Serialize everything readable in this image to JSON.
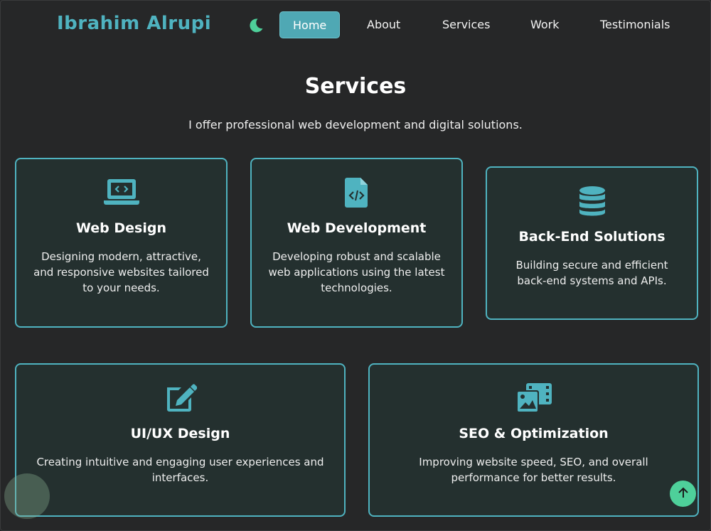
{
  "header": {
    "brand": "Ibrahim Alrupi",
    "theme_icon": "moon-icon",
    "nav": [
      {
        "label": "Home",
        "active": true
      },
      {
        "label": "About",
        "active": false
      },
      {
        "label": "Services",
        "active": false
      },
      {
        "label": "Work",
        "active": false
      },
      {
        "label": "Testimonials",
        "active": false
      }
    ]
  },
  "services": {
    "title": "Services",
    "subtitle": "I offer professional web development and digital solutions.",
    "cards": [
      {
        "icon": "laptop-code-icon",
        "title": "Web Design",
        "desc": "Designing modern, attractive, and responsive websites tailored to your needs."
      },
      {
        "icon": "file-code-icon",
        "title": "Web Development",
        "desc": "Developing robust and scalable web applications using the latest technologies."
      },
      {
        "icon": "database-icon",
        "title": "Back-End Solutions",
        "desc": "Building secure and efficient back-end systems and APIs."
      },
      {
        "icon": "edit-icon",
        "title": "UI/UX Design",
        "desc": "Creating intuitive and engaging user experiences and interfaces."
      },
      {
        "icon": "photo-film-icon",
        "title": "SEO & Optimization",
        "desc": "Improving website speed, SEO, and overall performance for better results."
      }
    ]
  },
  "scroll_top_icon": "arrow-up-icon",
  "colors": {
    "background": "#262728",
    "accent": "#4fb3c0",
    "card_bg": "#24302f",
    "nav_active": "#4fa8b4",
    "scroll_button": "#4ed09a",
    "moon": "#4ed09a"
  }
}
